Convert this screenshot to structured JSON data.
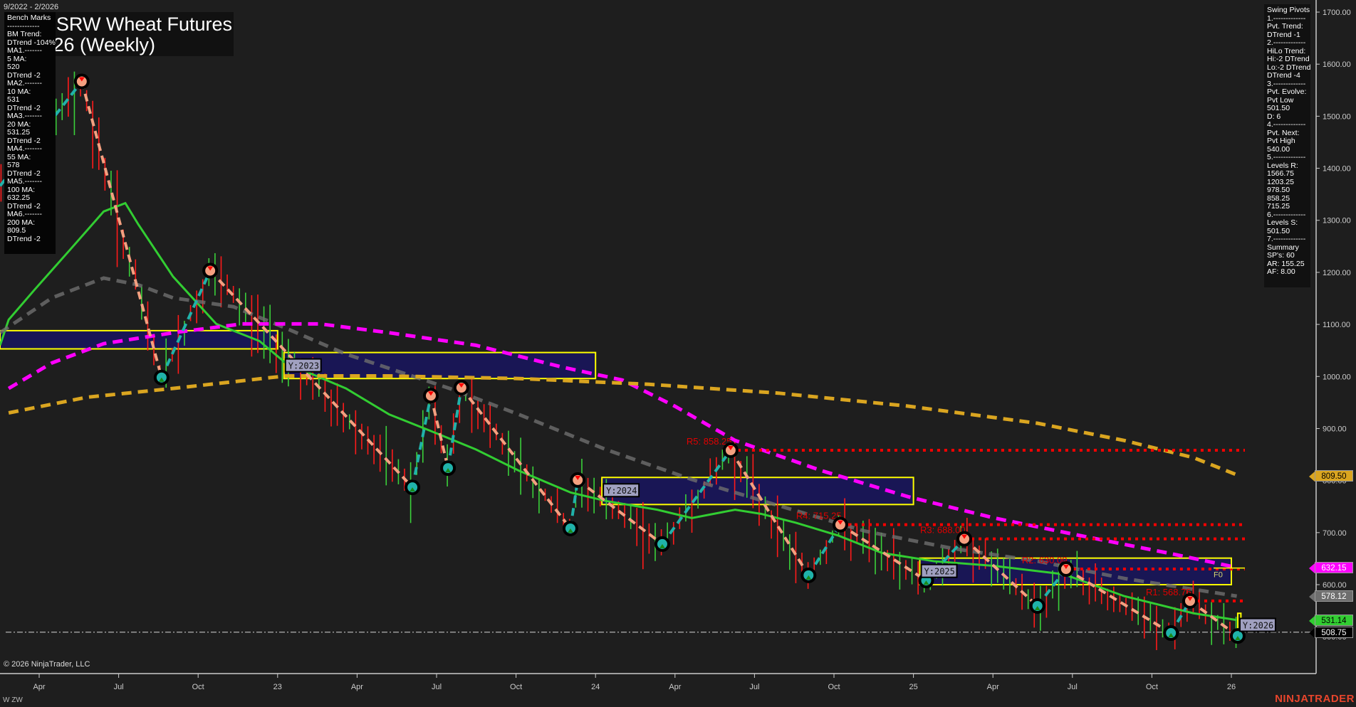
{
  "header": {
    "date_range": "9/2022 - 2/2026",
    "title_line1": "Chicago SRW Wheat Futures",
    "title_line2": "ZW 03-26 (Weekly)"
  },
  "bench_marks": {
    "lines": [
      "Bench Marks",
      "-------------",
      "BM Trend:",
      "DTrend -104%",
      "MA1.-------",
      "5 MA:",
      "520",
      "DTrend -2",
      "MA2.-------",
      "10 MA:",
      "531",
      "DTrend -2",
      "MA3.-------",
      "20 MA:",
      "531.25",
      "DTrend -2",
      "MA4.-------",
      "55 MA:",
      "578",
      "DTrend -2",
      "MA5.-------",
      "100 MA:",
      "632.25",
      "DTrend -2",
      "MA6.-------",
      "200 MA:",
      "809.5",
      "DTrend -2"
    ]
  },
  "swing_pivots": {
    "lines": [
      "Swing Pivots",
      "1.-------------",
      "Pvt. Trend:",
      "DTrend -1",
      "2.-------------",
      "HiLo Trend:",
      "Hi:-2 DTrend",
      "Lo:-2 DTrend",
      "DTrend -4",
      "3.-------------",
      "Pvt. Evolve:",
      "Pvt Low",
      "501.50",
      "D: 6",
      "4.-------------",
      "Pvt. Next:",
      "Pvt High",
      "540.00",
      "5.-------------",
      "Levels R:",
      "1566.75",
      "1203.25",
      "978.50",
      "858.25",
      "715.25",
      "6.-------------",
      "Levels S:",
      "501.50",
      "7.-------------",
      "Summary",
      "SP's: 60",
      "AR: 155.25",
      "AF: 8.00"
    ]
  },
  "footer": {
    "copyright": "© 2026 NinjaTrader, LLC",
    "symbol": "W ZW",
    "brand": "NINJATRADER"
  },
  "price_tags": [
    {
      "label": "809.50",
      "value": 809.5,
      "bg": "#daa520",
      "fg": "#000"
    },
    {
      "label": "632.15",
      "value": 632.15,
      "bg": "#ff00ff",
      "fg": "#fff"
    },
    {
      "label": "578.12",
      "value": 578.12,
      "bg": "#6e6e6e",
      "fg": "#fff"
    },
    {
      "label": "531.14",
      "value": 531.14,
      "bg": "#32cd32",
      "fg": "#000"
    },
    {
      "label": "508.75",
      "value": 508.75,
      "bg": "#000",
      "fg": "#fff"
    }
  ],
  "chart_data": {
    "type": "line",
    "title": "Chicago SRW Wheat Futures (Weekly)",
    "xlim": [
      2022.127,
      2026.1
    ],
    "ylim": [
      480,
      1720
    ],
    "grid": false,
    "y_ticks": [
      {
        "label": "1700.00",
        "value": 1700
      },
      {
        "label": "1600.00",
        "value": 1600
      },
      {
        "label": "1500.00",
        "value": 1500
      },
      {
        "label": "1400.00",
        "value": 1400
      },
      {
        "label": "1300.00",
        "value": 1300
      },
      {
        "label": "1200.00",
        "value": 1200
      },
      {
        "label": "1100.00",
        "value": 1100
      },
      {
        "label": "1000.00",
        "value": 1000
      },
      {
        "label": "900.00",
        "value": 900
      },
      {
        "label": "800.00",
        "value": 800
      },
      {
        "label": "700.00",
        "value": 700
      },
      {
        "label": "600.00",
        "value": 600
      },
      {
        "label": "500.00",
        "value": 500
      }
    ],
    "x_ticks": [
      {
        "label": "Apr",
        "t": 2022.25
      },
      {
        "label": "Jul",
        "t": 2022.5
      },
      {
        "label": "Oct",
        "t": 2022.75
      },
      {
        "label": "23",
        "t": 2023.0
      },
      {
        "label": "Apr",
        "t": 2023.25
      },
      {
        "label": "Jul",
        "t": 2023.5
      },
      {
        "label": "Oct",
        "t": 2023.75
      },
      {
        "label": "24",
        "t": 2024.0
      },
      {
        "label": "Apr",
        "t": 2024.25
      },
      {
        "label": "Jul",
        "t": 2024.5
      },
      {
        "label": "Oct",
        "t": 2024.75
      },
      {
        "label": "25",
        "t": 2025.0
      },
      {
        "label": "Apr",
        "t": 2025.25
      },
      {
        "label": "Jul",
        "t": 2025.5
      },
      {
        "label": "Oct",
        "t": 2025.75
      },
      {
        "label": "26",
        "t": 2026.0
      }
    ],
    "moving_averages": [
      {
        "name": "20 MA",
        "color": "#32cd32",
        "style": "solid",
        "points": [
          [
            2022.127,
            1060
          ],
          [
            2022.154,
            1109
          ],
          [
            2022.236,
            1167
          ],
          [
            2022.345,
            1242
          ],
          [
            2022.453,
            1317
          ],
          [
            2022.521,
            1333
          ],
          [
            2022.562,
            1292
          ],
          [
            2022.671,
            1192
          ],
          [
            2022.807,
            1101
          ],
          [
            2022.943,
            1068
          ],
          [
            2023.025,
            1026
          ],
          [
            2023.215,
            977
          ],
          [
            2023.351,
            927
          ],
          [
            2023.487,
            894
          ],
          [
            2023.623,
            860
          ],
          [
            2023.759,
            819
          ],
          [
            2023.922,
            777
          ],
          [
            2024.031,
            761
          ],
          [
            2024.194,
            744
          ],
          [
            2024.303,
            728
          ],
          [
            2024.439,
            744
          ],
          [
            2024.521,
            736
          ],
          [
            2024.63,
            719
          ],
          [
            2024.765,
            694
          ],
          [
            2024.901,
            661
          ],
          [
            2025.065,
            645
          ],
          [
            2025.255,
            636
          ],
          [
            2025.473,
            620
          ],
          [
            2025.663,
            578
          ],
          [
            2025.881,
            545
          ],
          [
            2026.017,
            532
          ]
        ]
      },
      {
        "name": "55 MA",
        "color": "#6e6e6e",
        "style": "dashed",
        "points": [
          [
            2022.127,
            1084
          ],
          [
            2022.29,
            1151
          ],
          [
            2022.453,
            1189
          ],
          [
            2022.562,
            1176
          ],
          [
            2022.671,
            1151
          ],
          [
            2022.861,
            1134
          ],
          [
            2023.025,
            1093
          ],
          [
            2023.215,
            1043
          ],
          [
            2023.378,
            1010
          ],
          [
            2023.541,
            977
          ],
          [
            2023.759,
            927
          ],
          [
            2024.031,
            860
          ],
          [
            2024.303,
            802
          ],
          [
            2024.575,
            752
          ],
          [
            2024.847,
            703
          ],
          [
            2025.119,
            670
          ],
          [
            2025.391,
            645
          ],
          [
            2025.663,
            612
          ],
          [
            2026.017,
            578
          ]
        ]
      },
      {
        "name": "100 MA",
        "color": "#ff00ff",
        "style": "dashed",
        "points": [
          [
            2022.154,
            977
          ],
          [
            2022.29,
            1026
          ],
          [
            2022.453,
            1063
          ],
          [
            2022.671,
            1084
          ],
          [
            2022.889,
            1101
          ],
          [
            2023.133,
            1101
          ],
          [
            2023.351,
            1084
          ],
          [
            2023.623,
            1060
          ],
          [
            2023.895,
            1018
          ],
          [
            2024.085,
            993
          ],
          [
            2024.249,
            943
          ],
          [
            2024.439,
            877
          ],
          [
            2024.711,
            819
          ],
          [
            2024.983,
            769
          ],
          [
            2025.255,
            728
          ],
          [
            2025.527,
            694
          ],
          [
            2025.799,
            661
          ],
          [
            2026.017,
            633
          ]
        ]
      },
      {
        "name": "200 MA",
        "color": "#daa520",
        "style": "dashed",
        "points": [
          [
            2022.154,
            930
          ],
          [
            2022.399,
            960
          ],
          [
            2022.671,
            977
          ],
          [
            2023.025,
            1001
          ],
          [
            2023.351,
            1001
          ],
          [
            2023.759,
            996
          ],
          [
            2024.167,
            985
          ],
          [
            2024.575,
            968
          ],
          [
            2024.983,
            943
          ],
          [
            2025.391,
            910
          ],
          [
            2025.663,
            877
          ],
          [
            2025.881,
            844
          ],
          [
            2026.017,
            811
          ]
        ]
      }
    ],
    "swing_start": [
      2022.127,
      1366
    ],
    "pivots": [
      {
        "t": 2022.384,
        "p": 1566.75,
        "type": "high"
      },
      {
        "t": 2022.635,
        "p": 998,
        "type": "low"
      },
      {
        "t": 2022.788,
        "p": 1203.25,
        "type": "high"
      },
      {
        "t": 2023.424,
        "p": 787,
        "type": "low"
      },
      {
        "t": 2023.482,
        "p": 963,
        "type": "high"
      },
      {
        "t": 2023.536,
        "p": 824,
        "type": "low"
      },
      {
        "t": 2023.578,
        "p": 978.5,
        "type": "high"
      },
      {
        "t": 2023.921,
        "p": 708,
        "type": "low"
      },
      {
        "t": 2023.944,
        "p": 801,
        "type": "high"
      },
      {
        "t": 2024.21,
        "p": 678,
        "type": "low"
      },
      {
        "t": 2024.425,
        "p": 858.25,
        "type": "high"
      },
      {
        "t": 2024.67,
        "p": 618,
        "type": "low"
      },
      {
        "t": 2024.77,
        "p": 715.25,
        "type": "high"
      },
      {
        "t": 2025.04,
        "p": 608,
        "type": "low"
      },
      {
        "t": 2025.16,
        "p": 688,
        "type": "high"
      },
      {
        "t": 2025.39,
        "p": 559,
        "type": "low"
      },
      {
        "t": 2025.48,
        "p": 630,
        "type": "high"
      },
      {
        "t": 2025.81,
        "p": 507,
        "type": "low"
      },
      {
        "t": 2025.87,
        "p": 568.75,
        "type": "high"
      },
      {
        "t": 2026.02,
        "p": 501.5,
        "type": "low"
      }
    ],
    "resistance_levels": [
      {
        "label": "R5: 858.25",
        "value": 858.25,
        "from": 2024.425
      },
      {
        "label": "R4: 715.25",
        "value": 715.25,
        "from": 2024.77
      },
      {
        "label": "R3: 688.00",
        "value": 688,
        "from": 2025.16
      },
      {
        "label": "R2: 630.00",
        "value": 630,
        "from": 2025.48
      },
      {
        "label": "R1: 568.75",
        "value": 568.75,
        "from": 2025.87
      }
    ],
    "current_price": 508.75,
    "fib_label": {
      "label": "F0",
      "value": 632
    },
    "year_ranges": [
      {
        "label": "",
        "from": 2022.0,
        "to": 2023.0,
        "high": 1088,
        "low": 1053
      },
      {
        "label": "Y:2023",
        "from": 2023.02,
        "to": 2024.0,
        "high": 1046,
        "low": 996
      },
      {
        "label": "Y:2024",
        "from": 2024.02,
        "to": 2025.0,
        "high": 806,
        "low": 754
      },
      {
        "label": "Y:2025",
        "from": 2025.02,
        "to": 2026.0,
        "high": 651,
        "low": 600
      },
      {
        "label": "Y:2026",
        "from": 2026.02,
        "to": 2026.03,
        "high": 545,
        "low": 505
      }
    ]
  }
}
